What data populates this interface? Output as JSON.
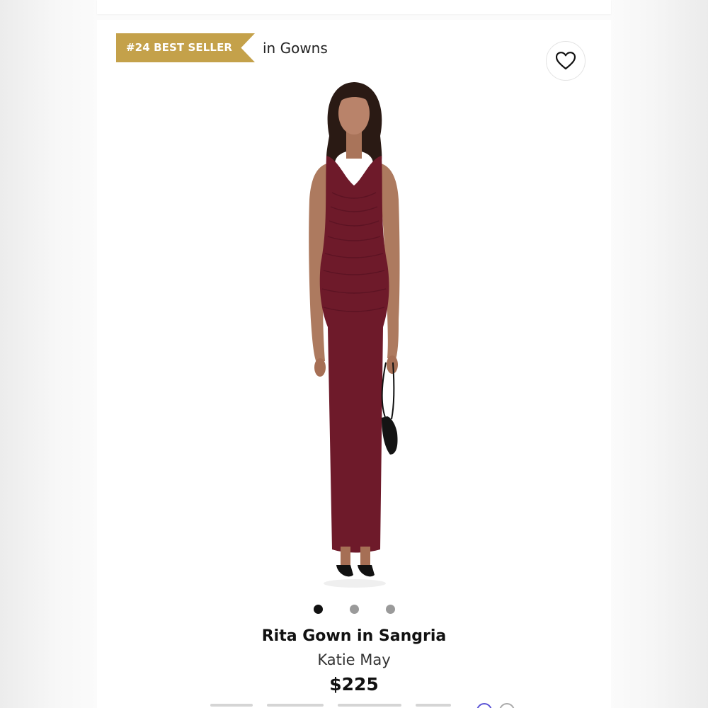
{
  "badge": {
    "text": "#24 BEST SELLER",
    "suffix": "in Gowns",
    "color": "#c4a14a"
  },
  "favorite": {
    "icon": "heart-outline-icon",
    "label": "Add to wishlist"
  },
  "product": {
    "name": "Rita Gown in Sangria",
    "brand": "Katie May",
    "price": "$225",
    "dress_color": "#6e1a2a"
  },
  "carousel": {
    "total": 3,
    "active_index": 0
  }
}
